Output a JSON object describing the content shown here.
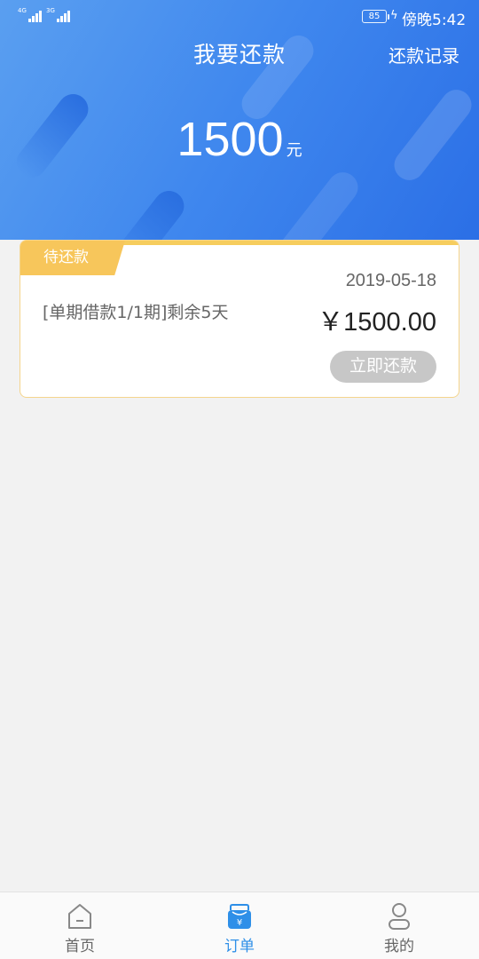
{
  "status_bar": {
    "signal_1": "4G",
    "signal_2": "3G",
    "battery": "85",
    "time": "傍晚5:42"
  },
  "header": {
    "title": "我要还款",
    "record_link": "还款记录",
    "amount": "1500",
    "unit": "元"
  },
  "card": {
    "badge": "待还款",
    "date": "2019-05-18",
    "description": "[单期借款1/1期]剩余5天",
    "price": "￥1500.00",
    "button": "立即还款"
  },
  "nav": {
    "items": [
      {
        "label": "首页",
        "icon": "home-icon"
      },
      {
        "label": "订单",
        "icon": "order-icon"
      },
      {
        "label": "我的",
        "icon": "user-icon"
      }
    ],
    "active_index": 1
  },
  "colors": {
    "header_blue": "#3f87ee",
    "badge_yellow": "#f7c65b",
    "nav_active": "#2e8fe8",
    "button_disabled": "#c7c7c7"
  }
}
